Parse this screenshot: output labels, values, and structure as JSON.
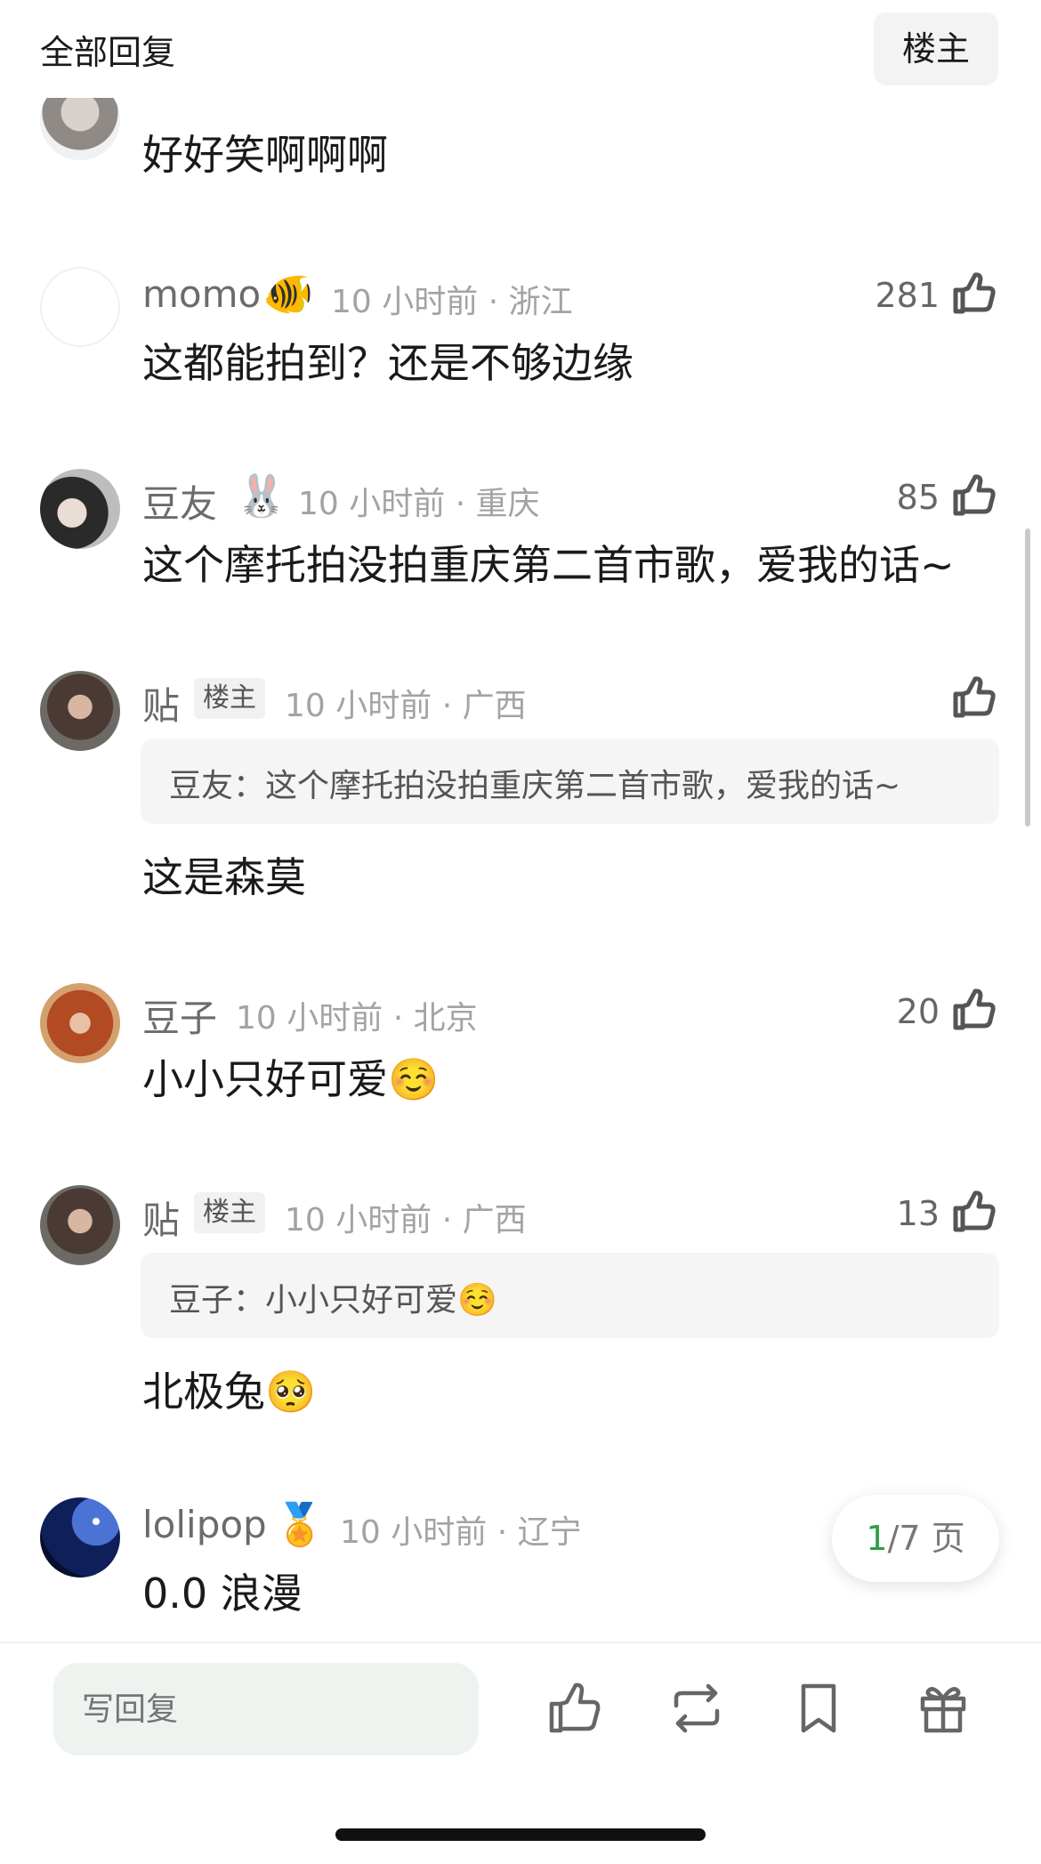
{
  "header": {
    "title": "全部回复",
    "owner_filter": "楼主"
  },
  "comments": [
    {
      "name": "",
      "meta": "",
      "likes": "",
      "text": "好好笑啊啊啊",
      "avatar": "gray"
    },
    {
      "name": "momo",
      "badge": "🐠",
      "meta": "10 小时前 · 浙江",
      "likes": "281",
      "text": "这都能拍到？还是不够边缘",
      "avatar": "white"
    },
    {
      "name": "豆友",
      "badge": "🐰",
      "meta": "10 小时前 · 重庆",
      "likes": "85",
      "text": "这个摩托拍没拍重庆第二首市歌，爱我的话~",
      "avatar": "girl-dark"
    },
    {
      "name": "贴",
      "owner_tag": "楼主",
      "meta": "10 小时前 · 广西",
      "likes": "",
      "quote": "豆友：这个摩托拍没拍重庆第二首市歌，爱我的话~",
      "text": "这是森莫",
      "avatar": "woman"
    },
    {
      "name": "豆子",
      "meta": "10 小时前 · 北京",
      "likes": "20",
      "text": "小小只好可爱☺️",
      "avatar": "redhair"
    },
    {
      "name": "贴",
      "owner_tag": "楼主",
      "meta": "10 小时前 · 广西",
      "likes": "13",
      "quote": "豆子：小小只好可爱☺️",
      "text": "北极兔🥺",
      "avatar": "woman"
    },
    {
      "name": "lolipop",
      "badge": "🏅",
      "meta": "10 小时前 · 辽宁",
      "likes": "",
      "text": "0.0 浪漫",
      "avatar": "night"
    }
  ],
  "pagination": {
    "current": "1",
    "total": "/7 页",
    "accent": "#2f9e44"
  },
  "bottom_bar": {
    "reply_placeholder": "写回复",
    "icons": [
      "thumbs-up-icon",
      "repost-icon",
      "bookmark-icon",
      "gift-icon"
    ]
  }
}
